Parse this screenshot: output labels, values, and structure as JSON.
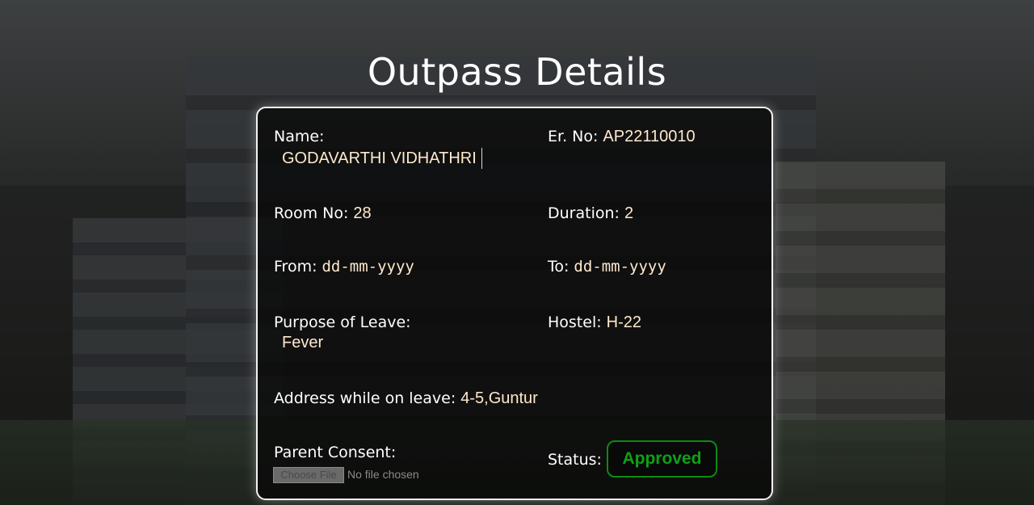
{
  "page": {
    "title": "Outpass Details"
  },
  "form": {
    "name": {
      "label": "Name:",
      "value": "GODAVARTHI VIDHATHRI"
    },
    "er_no": {
      "label": "Er. No:",
      "value": "AP22110010"
    },
    "room_no": {
      "label": "Room No:",
      "value": "28"
    },
    "duration": {
      "label": "Duration:",
      "value": "2"
    },
    "from": {
      "label": "From:",
      "value": "dd-mm-yyyy"
    },
    "to": {
      "label": "To:",
      "value": "dd-mm-yyyy"
    },
    "purpose": {
      "label": "Purpose of Leave:",
      "value": "Fever"
    },
    "hostel": {
      "label": "Hostel:",
      "value": "H-22"
    },
    "address": {
      "label": "Address while on leave:",
      "value": "4-5,Guntur"
    },
    "parent_consent": {
      "label": "Parent Consent:",
      "button_label": "Choose File",
      "file_status": "No file chosen"
    },
    "status": {
      "label": "Status:",
      "value": "Approved",
      "color": "#0fa016"
    }
  }
}
